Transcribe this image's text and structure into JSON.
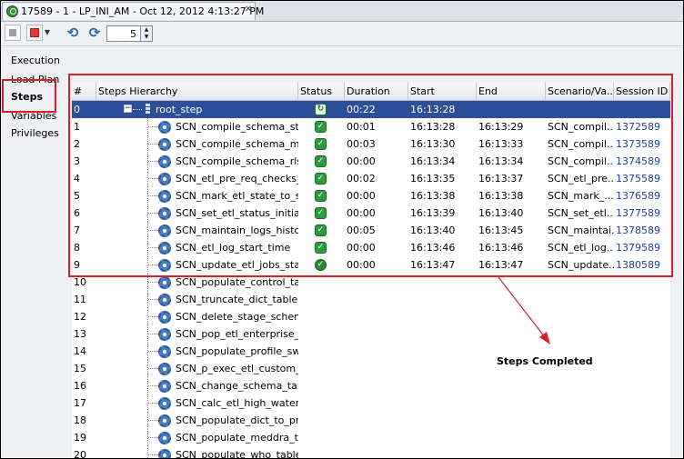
{
  "tab": {
    "title": "17589 - 1 - LP_INI_AM - Oct 12, 2012 4:13:27 PM",
    "close": "✕"
  },
  "toolbar": {
    "refresh_interval": "5"
  },
  "nav": {
    "items": [
      {
        "label": "Execution"
      },
      {
        "label": "Load Plan"
      },
      {
        "label": "Steps"
      },
      {
        "label": "Variables"
      },
      {
        "label": "Privileges"
      }
    ]
  },
  "grid": {
    "columns": [
      "#",
      "Steps Hierarchy",
      "Status",
      "Duration",
      "Start",
      "End",
      "Scenario/Va...",
      "Session ID"
    ],
    "root": {
      "num": "0",
      "name": "root_step",
      "duration": "00:22",
      "start": "16:13:28",
      "end": "",
      "scenario": "",
      "session": ""
    },
    "rows": [
      {
        "num": "1",
        "name": "SCN_compile_schema_stage",
        "duration": "00:01",
        "start": "16:13:28",
        "end": "16:13:29",
        "scenario": "SCN_compil...",
        "session": "1372589",
        "status": "done"
      },
      {
        "num": "2",
        "name": "SCN_compile_schema_mart",
        "duration": "00:03",
        "start": "16:13:30",
        "end": "16:13:33",
        "scenario": "SCN_compil...",
        "session": "1373589",
        "status": "done"
      },
      {
        "num": "3",
        "name": "SCN_compile_schema_rls",
        "duration": "00:00",
        "start": "16:13:34",
        "end": "16:13:34",
        "scenario": "SCN_compil...",
        "session": "1374589",
        "status": "done"
      },
      {
        "num": "4",
        "name": "SCN_etl_pre_req_checks_initial",
        "duration": "00:02",
        "start": "16:13:35",
        "end": "16:13:37",
        "scenario": "SCN_etl_pre...",
        "session": "1375589",
        "status": "done"
      },
      {
        "num": "5",
        "name": "SCN_mark_etl_state_to_started",
        "duration": "00:00",
        "start": "16:13:38",
        "end": "16:13:38",
        "scenario": "SCN_mark_...",
        "session": "1376589",
        "status": "done"
      },
      {
        "num": "6",
        "name": "SCN_set_etl_status_initial_start",
        "duration": "00:00",
        "start": "16:13:39",
        "end": "16:13:40",
        "scenario": "SCN_set_etl...",
        "session": "1377589",
        "status": "done"
      },
      {
        "num": "7",
        "name": "SCN_maintain_logs_history",
        "duration": "00:05",
        "start": "16:13:40",
        "end": "16:13:45",
        "scenario": "SCN_maintai...",
        "session": "1378589",
        "status": "done"
      },
      {
        "num": "8",
        "name": "SCN_etl_log_start_time",
        "duration": "00:00",
        "start": "16:13:46",
        "end": "16:13:46",
        "scenario": "SCN_etl_log...",
        "session": "1379589",
        "status": "done"
      },
      {
        "num": "9",
        "name": "SCN_update_etl_jobs_stage_star",
        "duration": "00:00",
        "start": "16:13:47",
        "end": "16:13:47",
        "scenario": "SCN_update...",
        "session": "1380589",
        "status": "running"
      },
      {
        "num": "10",
        "name": "SCN_populate_control_table",
        "duration": "",
        "start": "",
        "end": "",
        "scenario": "",
        "session": "",
        "status": "none"
      },
      {
        "num": "11",
        "name": "SCN_truncate_dict_tables",
        "duration": "",
        "start": "",
        "end": "",
        "scenario": "",
        "session": "",
        "status": "none"
      },
      {
        "num": "12",
        "name": "SCN_delete_stage_schema_stats",
        "duration": "",
        "start": "",
        "end": "",
        "scenario": "",
        "session": "",
        "status": "none"
      },
      {
        "num": "13",
        "name": "SCN_pop_etl_enterprise_to_proce",
        "duration": "",
        "start": "",
        "end": "",
        "scenario": "",
        "session": "",
        "status": "none"
      },
      {
        "num": "14",
        "name": "SCN_populate_profile_switches",
        "duration": "",
        "start": "",
        "end": "",
        "scenario": "",
        "session": "",
        "status": "none"
      },
      {
        "num": "15",
        "name": "SCN_p_exec_etl_custom_hooks_P",
        "duration": "",
        "start": "",
        "end": "",
        "scenario": "",
        "session": "",
        "status": "none"
      },
      {
        "num": "16",
        "name": "SCN_change_schema_tables_logg",
        "duration": "",
        "start": "",
        "end": "",
        "scenario": "",
        "session": "",
        "status": "none"
      },
      {
        "num": "17",
        "name": "SCN_calc_etl_high_water_mark",
        "duration": "",
        "start": "",
        "end": "",
        "scenario": "",
        "session": "",
        "status": "none"
      },
      {
        "num": "18",
        "name": "SCN_populate_dict_to_process",
        "duration": "",
        "start": "",
        "end": "",
        "scenario": "",
        "session": "",
        "status": "none"
      },
      {
        "num": "19",
        "name": "SCN_populate_meddra_tables",
        "duration": "",
        "start": "",
        "end": "",
        "scenario": "",
        "session": "",
        "status": "none"
      },
      {
        "num": "20",
        "name": "SCN_populate_who_tables",
        "duration": "",
        "start": "",
        "end": "",
        "scenario": "",
        "session": "",
        "status": "none"
      }
    ]
  },
  "annotation": {
    "label": "Steps Completed",
    "color": "#d8202a"
  }
}
